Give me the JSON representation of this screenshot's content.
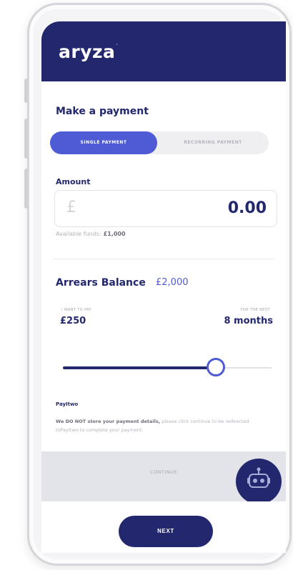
{
  "header": {
    "logo_text": "aryza",
    "logo_mark": "·"
  },
  "payment": {
    "title": "Make a payment",
    "tabs": [
      {
        "label": "SINGLE PAYMENT",
        "selected": true
      },
      {
        "label": "RECURRING PAYMENT",
        "selected": false
      }
    ],
    "amount_label": "Amount",
    "currency_symbol": "£",
    "amount_value": "0.00",
    "available_funds_label": "Available funds:",
    "available_funds_value": "£1,000"
  },
  "arrears": {
    "title": "Arrears Balance",
    "balance": "£2,000",
    "want_to_pay_label": "I WANT TO PAY",
    "want_to_pay_value": "£250",
    "for_the_next_label": "FOR THE NEXT",
    "for_the_next_value": "8 months",
    "slider_fraction": 0.75
  },
  "payitwo": {
    "title": "PayItwo",
    "bold_text": "We DO NOT store your payment details,",
    "text": " please click continue to be redirected toPayItwo to complete your payment."
  },
  "actions": {
    "continue_label": "CONTINUE",
    "next_label": "NEXT"
  },
  "colors": {
    "navy": "#23286e",
    "accent": "#4f5bd5"
  },
  "icons": {
    "chat_bot": "robot-icon"
  }
}
